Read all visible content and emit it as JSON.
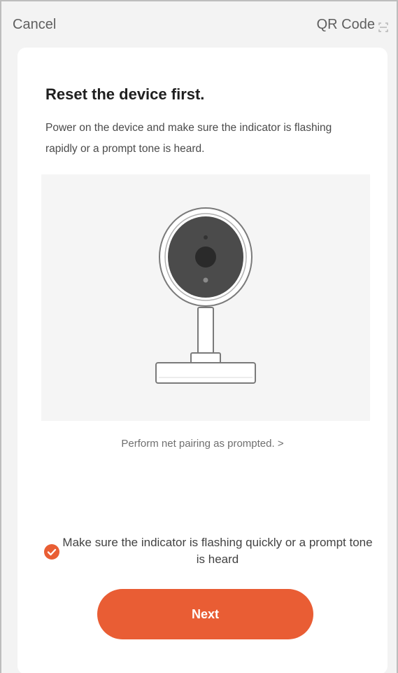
{
  "header": {
    "cancel_label": "Cancel",
    "qr_label": "QR Code",
    "qr_icon": "qr-code-icon"
  },
  "main": {
    "title": "Reset the device first.",
    "description": "Power on the device and make sure the indicator is flashing rapidly or a prompt tone is heard.",
    "illustration": "camera-illustration",
    "pairing_link": "Perform net pairing as prompted. >",
    "confirmation": {
      "label": "Make sure the indicator is flashing quickly or a prompt tone is heard",
      "checked": true,
      "icon": "check-circle-icon"
    },
    "next_label": "Next"
  },
  "colors": {
    "accent": "#e95d34",
    "background": "#f3f3f3",
    "card": "#ffffff"
  }
}
